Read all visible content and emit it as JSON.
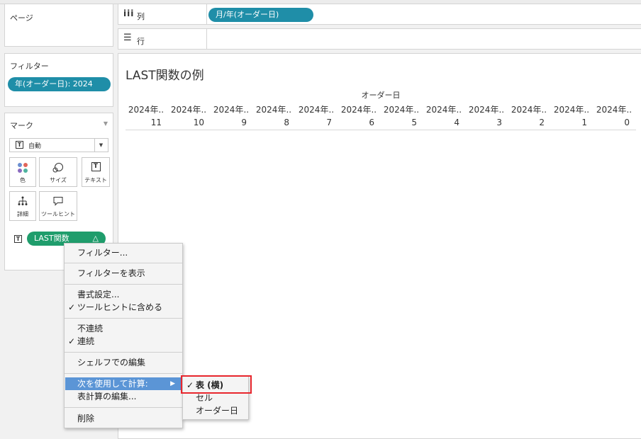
{
  "left_panel": {
    "pages_title": "ページ",
    "filters_title": "フィルター",
    "filter_pill": "年(オーダー日): 2024",
    "marks_title": "マーク",
    "mark_type": "自動",
    "mark_buttons": [
      {
        "label": "色",
        "icon": "color-dots-icon"
      },
      {
        "label": "サイズ",
        "icon": "size-circles-icon"
      },
      {
        "label": "テキスト",
        "icon": "text-box-icon"
      },
      {
        "label": "詳細",
        "icon": "detail-tree-icon"
      },
      {
        "label": "ツールヒント",
        "icon": "tooltip-bubble-icon"
      }
    ],
    "mark_field_pill": "LAST関数",
    "mark_field_delta": "△"
  },
  "shelves": {
    "columns_label": "列",
    "columns_pill": "月/年(オーダー日)",
    "rows_label": "行"
  },
  "view": {
    "title": "LAST関数の例",
    "header_field": "オーダー日",
    "column_headers": [
      "2024年..",
      "2024年..",
      "2024年..",
      "2024年..",
      "2024年..",
      "2024年..",
      "2024年..",
      "2024年..",
      "2024年..",
      "2024年..",
      "2024年..",
      "2024年.."
    ],
    "values": [
      "11",
      "10",
      "9",
      "8",
      "7",
      "6",
      "5",
      "4",
      "3",
      "2",
      "1",
      "0"
    ]
  },
  "context_menu": {
    "items": [
      {
        "label": "フィルター...",
        "checked": false
      },
      {
        "label": "フィルターを表示",
        "checked": false
      },
      {
        "label": "書式設定...",
        "checked": false
      },
      {
        "label": "ツールヒントに含める",
        "checked": true
      },
      {
        "label": "不連続",
        "checked": false
      },
      {
        "label": "連続",
        "checked": true
      },
      {
        "label": "シェルフでの編集",
        "checked": false
      },
      {
        "label": "次を使用して計算:",
        "checked": false,
        "submenu_arrow": "▶"
      },
      {
        "label": "表計算の編集...",
        "checked": false
      },
      {
        "label": "削除",
        "checked": false
      }
    ],
    "check_glyph": "✓"
  },
  "submenu": {
    "items": [
      {
        "label": "表 (横)",
        "checked": true
      },
      {
        "label": "セル",
        "checked": false
      },
      {
        "label": "オーダー日",
        "checked": false
      }
    ],
    "highlight_color": "#e8262d"
  }
}
